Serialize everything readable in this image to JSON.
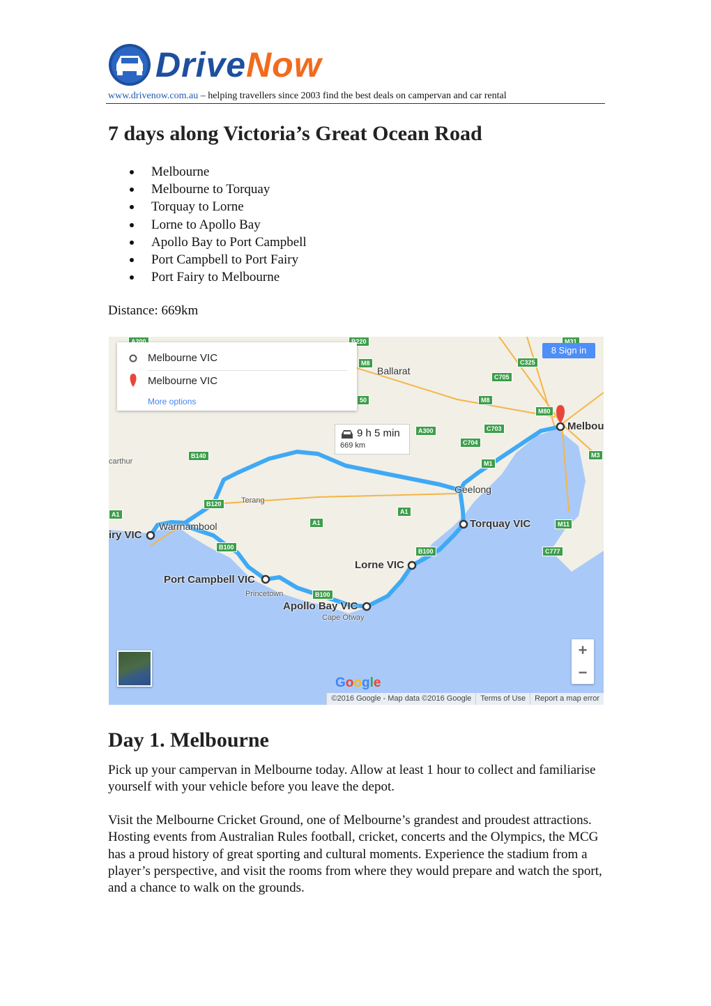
{
  "header": {
    "logo": {
      "drive": "Drive",
      "now": "Now"
    },
    "url": "www.drivenow.com.au",
    "tagline": " – helping travellers since 2003 find the best deals on campervan and car rental"
  },
  "title": "7 days along Victoria’s Great Ocean Road",
  "itinerary": [
    "Melbourne",
    "Melbourne to Torquay",
    "Torquay to Lorne",
    "Lorne to Apollo Bay",
    "Apollo Bay to Port Campbell",
    "Port Campbell to Port Fairy",
    "Port Fairy to Melbourne"
  ],
  "distance": "Distance: 669km",
  "map": {
    "origin": "Melbourne VIC",
    "destination": "Melbourne VIC",
    "more_options": "More options",
    "sign_in": "Sign in",
    "duration": "9 h 5 min",
    "distance": "669 km",
    "places": {
      "melbourne": "Melbou",
      "torquay": "Torquay VIC",
      "lorne": "Lorne VIC",
      "apollo": "Apollo Bay VIC",
      "campbell": "Port Campbell VIC",
      "fairy": "iry VIC",
      "warrnambool": "Warrnambool",
      "geelong": "Geelong",
      "ballarat": "Ballarat",
      "terang": "Terang",
      "princetown": "Princetown",
      "otway": "Cape Otway",
      "carthur": "carthur"
    },
    "roads": [
      "A200",
      "B220",
      "M8",
      "C325",
      "M31",
      "C705",
      "M8",
      "M80",
      "A300",
      "C703",
      "C704",
      "M1",
      "M3",
      "B140",
      "B120",
      "A1",
      "A1",
      "A1",
      "M11",
      "C777",
      "B100",
      "B100",
      "B100",
      "50"
    ],
    "google": "Google",
    "copyright": "©2016 Google - Map data ©2016 Google",
    "terms": "Terms of Use",
    "report": "Report a map error",
    "zoom_in": "+",
    "zoom_out": "−",
    "colors": {
      "route": "#3fa9f5",
      "sea": "#a9c9f8",
      "land": "#f1efe6"
    }
  },
  "day1": {
    "heading": "Day 1. Melbourne",
    "p1": "Pick up your campervan in Melbourne today. Allow at least 1 hour to collect and familiarise yourself with your vehicle before you leave the depot.",
    "p2": "Visit the Melbourne Cricket Ground, one of Melbourne’s grandest and proudest attractions. Hosting events from Australian Rules football, cricket, concerts and the Olympics, the MCG has a proud history of great sporting and cultural moments. Experience the stadium from a player’s perspective, and visit the rooms from where they would prepare and watch the sport, and a chance to walk on the grounds."
  }
}
